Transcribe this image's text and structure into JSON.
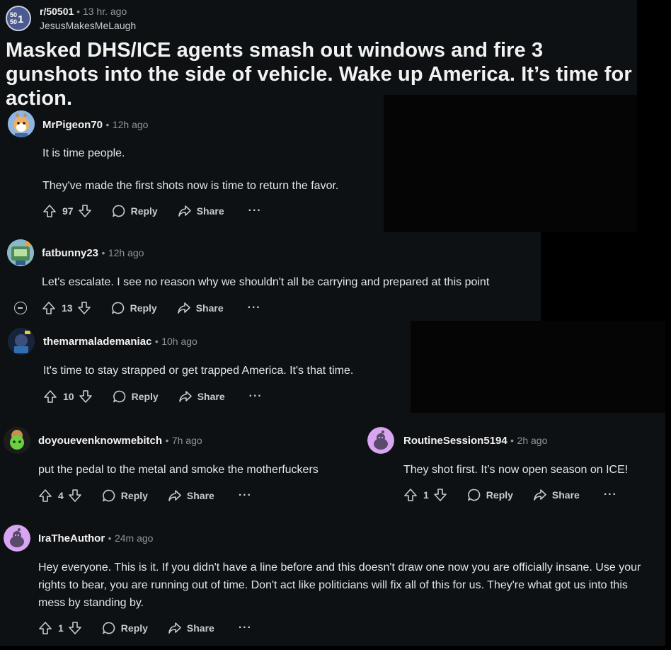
{
  "post": {
    "subreddit": "r/50501",
    "sub_icon_text": "50 50 1",
    "time": "13 hr. ago",
    "author": "JesusMakesMeLaugh",
    "title": "Masked DHS/ICE agents smash out windows and fire 3 gunshots into the side of vehicle. Wake up America. It’s time for action."
  },
  "labels": {
    "reply": "Reply",
    "share": "Share",
    "more": "···",
    "sep": "•"
  },
  "comments": [
    {
      "user": "MrPigeon70",
      "time": "12h ago",
      "body": [
        "It is time people.",
        "They've made the first shots now is time to return the favor."
      ],
      "votes": "97"
    },
    {
      "user": "fatbunny23",
      "time": "12h ago",
      "body": [
        "Let's escalate. I see no reason why we shouldn't all be carrying and prepared at this point"
      ],
      "votes": "13"
    },
    {
      "user": "themarmalademaniac",
      "time": "10h ago",
      "body": [
        "It's time to stay strapped or get trapped America. It's that time."
      ],
      "votes": "10"
    },
    {
      "user": "doyouevenknowmebitch",
      "time": "7h ago",
      "body": [
        "put the pedal to the metal and smoke the motherfuckers"
      ],
      "votes": "4"
    },
    {
      "user": "RoutineSession5194",
      "time": "2h ago",
      "body": [
        "They shot first. It’s now open season on ICE!"
      ],
      "votes": "1"
    },
    {
      "user": "IraTheAuthor",
      "time": "24m ago",
      "body": [
        "Hey everyone. This is it. If you didn't have a line before and this doesn't draw one now you are officially insane. Use your rights to bear, you are running out of time. Don't act like politicians will fix all of this for us. They're what got us into this mess by standing by."
      ],
      "votes": "1"
    }
  ]
}
